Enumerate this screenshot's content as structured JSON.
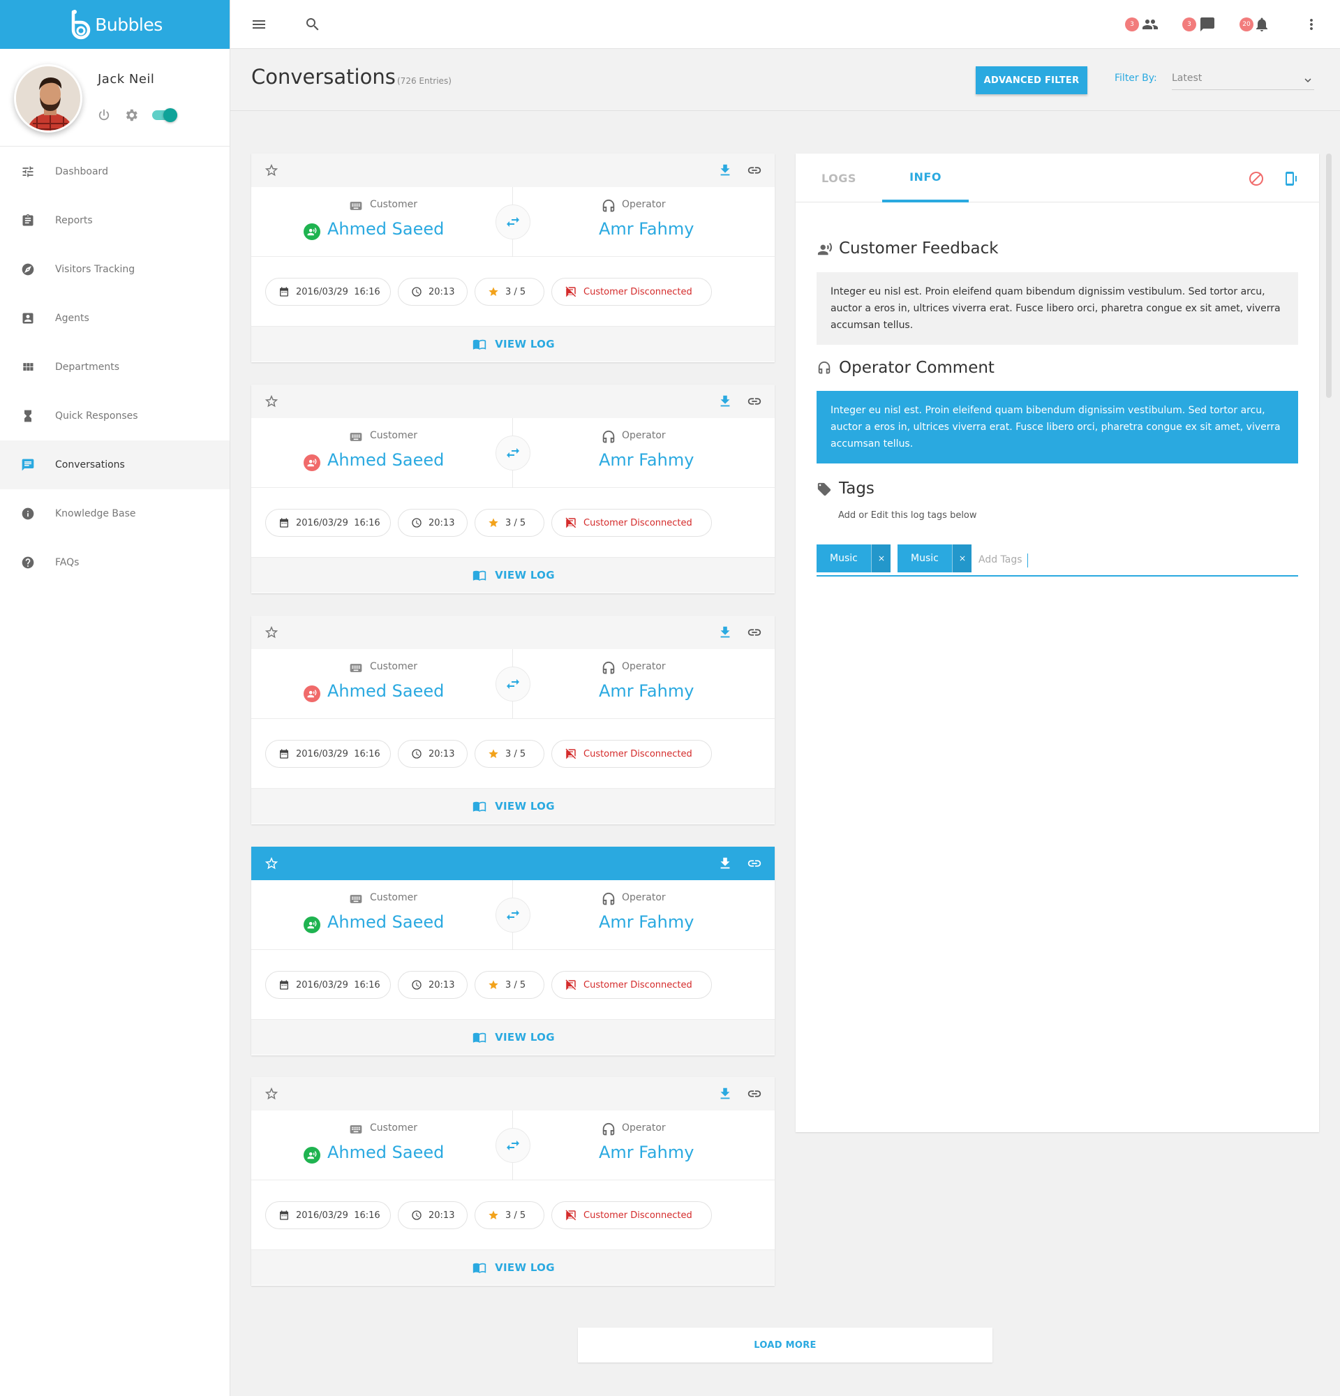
{
  "brand": {
    "name": "Bubbles",
    "color": "#2aa9e0"
  },
  "profile": {
    "name": "Jack Neil",
    "status_on": true
  },
  "sidebar": {
    "items": [
      {
        "label": "Dashboard",
        "icon": "sliders-icon",
        "active": false
      },
      {
        "label": "Reports",
        "icon": "clipboard-icon",
        "active": false
      },
      {
        "label": "Visitors Tracking",
        "icon": "compass-icon",
        "active": false
      },
      {
        "label": "Agents",
        "icon": "contact-card-icon",
        "active": false
      },
      {
        "label": "Departments",
        "icon": "grid-icon",
        "active": false
      },
      {
        "label": "Quick Responses",
        "icon": "hourglass-icon",
        "active": false
      },
      {
        "label": "Conversations",
        "icon": "chat-icon",
        "active": true
      },
      {
        "label": "Knowledge Base",
        "icon": "info-icon",
        "active": false
      },
      {
        "label": "FAQs",
        "icon": "help-icon",
        "active": false
      }
    ]
  },
  "topbar": {
    "badges": {
      "people": "3",
      "messages": "3",
      "notifications": "20"
    }
  },
  "header": {
    "title": "Conversations",
    "count": "(726 Entries)",
    "advanced_filter": "ADVANCED FILTER",
    "filter_label": "Filter By:",
    "filter_value": "Latest"
  },
  "conversations": [
    {
      "customer_label": "Customer",
      "customer": "Ahmed Saeed",
      "customer_status": "online",
      "operator_label": "Operator",
      "operator": "Amr Fahmy",
      "date": "2016/03/29",
      "time": "16:16",
      "duration": "20:13",
      "rating": "3 / 5",
      "status": "Customer Disconnected",
      "view_log": "VIEW LOG",
      "selected": false
    },
    {
      "customer_label": "Customer",
      "customer": "Ahmed Saeed",
      "customer_status": "offline",
      "operator_label": "Operator",
      "operator": "Amr Fahmy",
      "date": "2016/03/29",
      "time": "16:16",
      "duration": "20:13",
      "rating": "3 / 5",
      "status": "Customer Disconnected",
      "view_log": "VIEW LOG",
      "selected": false
    },
    {
      "customer_label": "Customer",
      "customer": "Ahmed Saeed",
      "customer_status": "offline",
      "operator_label": "Operator",
      "operator": "Amr Fahmy",
      "date": "2016/03/29",
      "time": "16:16",
      "duration": "20:13",
      "rating": "3 / 5",
      "status": "Customer Disconnected",
      "view_log": "VIEW LOG",
      "selected": false
    },
    {
      "customer_label": "Customer",
      "customer": "Ahmed Saeed",
      "customer_status": "online",
      "operator_label": "Operator",
      "operator": "Amr Fahmy",
      "date": "2016/03/29",
      "time": "16:16",
      "duration": "20:13",
      "rating": "3 / 5",
      "status": "Customer Disconnected",
      "view_log": "VIEW LOG",
      "selected": true
    },
    {
      "customer_label": "Customer",
      "customer": "Ahmed Saeed",
      "customer_status": "online",
      "operator_label": "Operator",
      "operator": "Amr Fahmy",
      "date": "2016/03/29",
      "time": "16:16",
      "duration": "20:13",
      "rating": "3 / 5",
      "status": "Customer Disconnected",
      "view_log": "VIEW LOG",
      "selected": false
    }
  ],
  "load_more": "LOAD MORE",
  "panel": {
    "tabs": [
      {
        "label": "LOGS",
        "active": false
      },
      {
        "label": "INFO",
        "active": true
      }
    ],
    "feedback_title": "Customer Feedback",
    "feedback_text": "Integer eu nisl est. Proin eleifend quam bibendum dignissim vestibulum. Sed tortor arcu, auctor a eros in, ultrices viverra erat. Fusce libero orci, pharetra congue ex sit amet, viverra accumsan tellus.",
    "comment_title": "Operator Comment",
    "comment_text": "Integer eu nisl est. Proin eleifend quam bibendum dignissim vestibulum. Sed tortor arcu, auctor a eros in, ultrices viverra erat. Fusce libero orci, pharetra congue ex sit amet, viverra accumsan tellus.",
    "tags_title": "Tags",
    "tags_hint": "Add or Edit this log tags below",
    "tags": [
      "Music",
      "Music"
    ],
    "tags_placeholder": "Add Tags"
  },
  "colors": {
    "accent": "#2aa9e0",
    "online": "#1fb350",
    "offline": "#f06a6a",
    "danger": "#d42b2b",
    "star": "#f2a21b"
  }
}
